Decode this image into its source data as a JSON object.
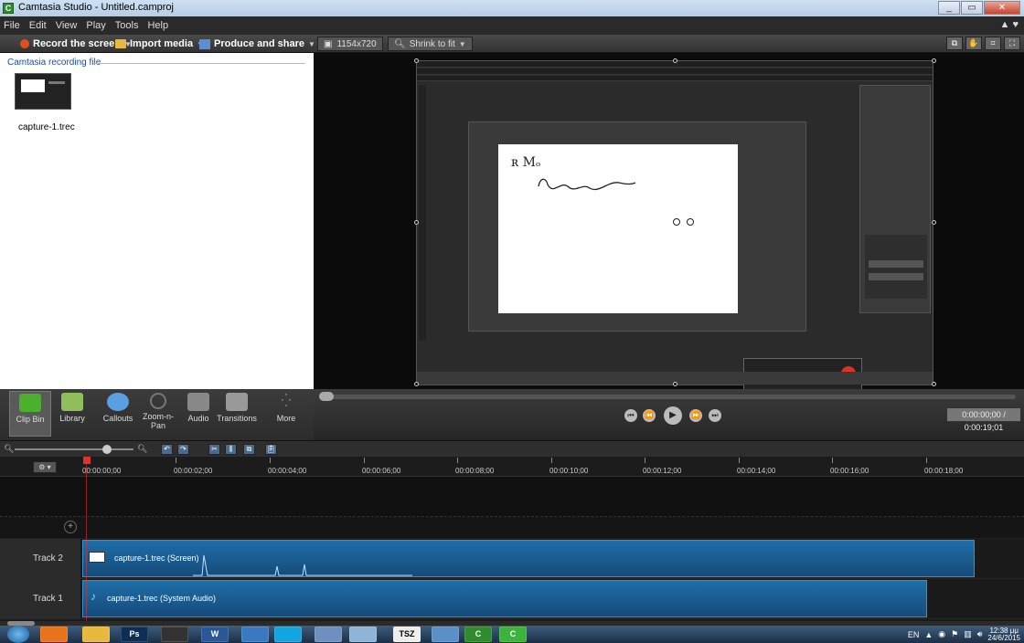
{
  "window": {
    "title": "Camtasia Studio - Untitled.camproj",
    "app_icon": "C",
    "min_icon": "minimize-icon",
    "max_icon": "maximize-icon",
    "close_icon": "close-icon"
  },
  "menu": [
    "File",
    "Edit",
    "View",
    "Play",
    "Tools",
    "Help"
  ],
  "toolbar": {
    "record_label": "Record the screen",
    "import_label": "Import media",
    "produce_label": "Produce and share",
    "dimensions": "1154x720",
    "zoom": "Shrink to fit"
  },
  "clip_bin": {
    "header": "Camtasia recording file",
    "file_name": "capture-1.trec"
  },
  "tabs": [
    {
      "label": "Clip Bin",
      "icon": "film-icon",
      "color": "#4caf2e"
    },
    {
      "label": "Library",
      "icon": "library-icon",
      "color": "#8fbf5a"
    },
    {
      "label": "Callouts",
      "icon": "callout-icon",
      "color": "#5aa0e0"
    },
    {
      "label": "Zoom-n-Pan",
      "icon": "magnifier-icon",
      "color": "#777777"
    },
    {
      "label": "Audio",
      "icon": "speaker-icon",
      "color": "#888888"
    },
    {
      "label": "Transitions",
      "icon": "transitions-icon",
      "color": "#999999"
    },
    {
      "label": "More",
      "icon": "more-icon",
      "color": "#666666"
    }
  ],
  "player": {
    "time": "0:00:00;00 / 0:00:19;01"
  },
  "ruler": {
    "labels": [
      "00:00:00;00",
      "00:00:02;00",
      "00:00:04;00",
      "00:00:06;00",
      "00:00:08;00",
      "00:00:10;00",
      "00:00:12;00",
      "00:00:14;00",
      "00:00:16;00",
      "00:00:18;00"
    ]
  },
  "tracks": [
    {
      "label": "Track 2",
      "clip": "capture-1.trec (Screen)"
    },
    {
      "label": "Track 1",
      "clip": "capture-1.trec (System Audio)"
    }
  ],
  "taskbar": {
    "lang": "EN",
    "time": "12:38 μμ",
    "date": "24/6/2015",
    "apps": [
      "firefox",
      "explorer",
      "Ps",
      "media",
      "W",
      "network",
      "skype",
      "app",
      "paint",
      "TSZ",
      "app2",
      "C",
      "C"
    ]
  },
  "canvas_preview": {
    "handwriting": "ʀ Mₒ"
  },
  "colors": {
    "accent_record": "#e24e1b",
    "clip_blue": "#1f6ea8",
    "playhead": "#dd3333"
  }
}
